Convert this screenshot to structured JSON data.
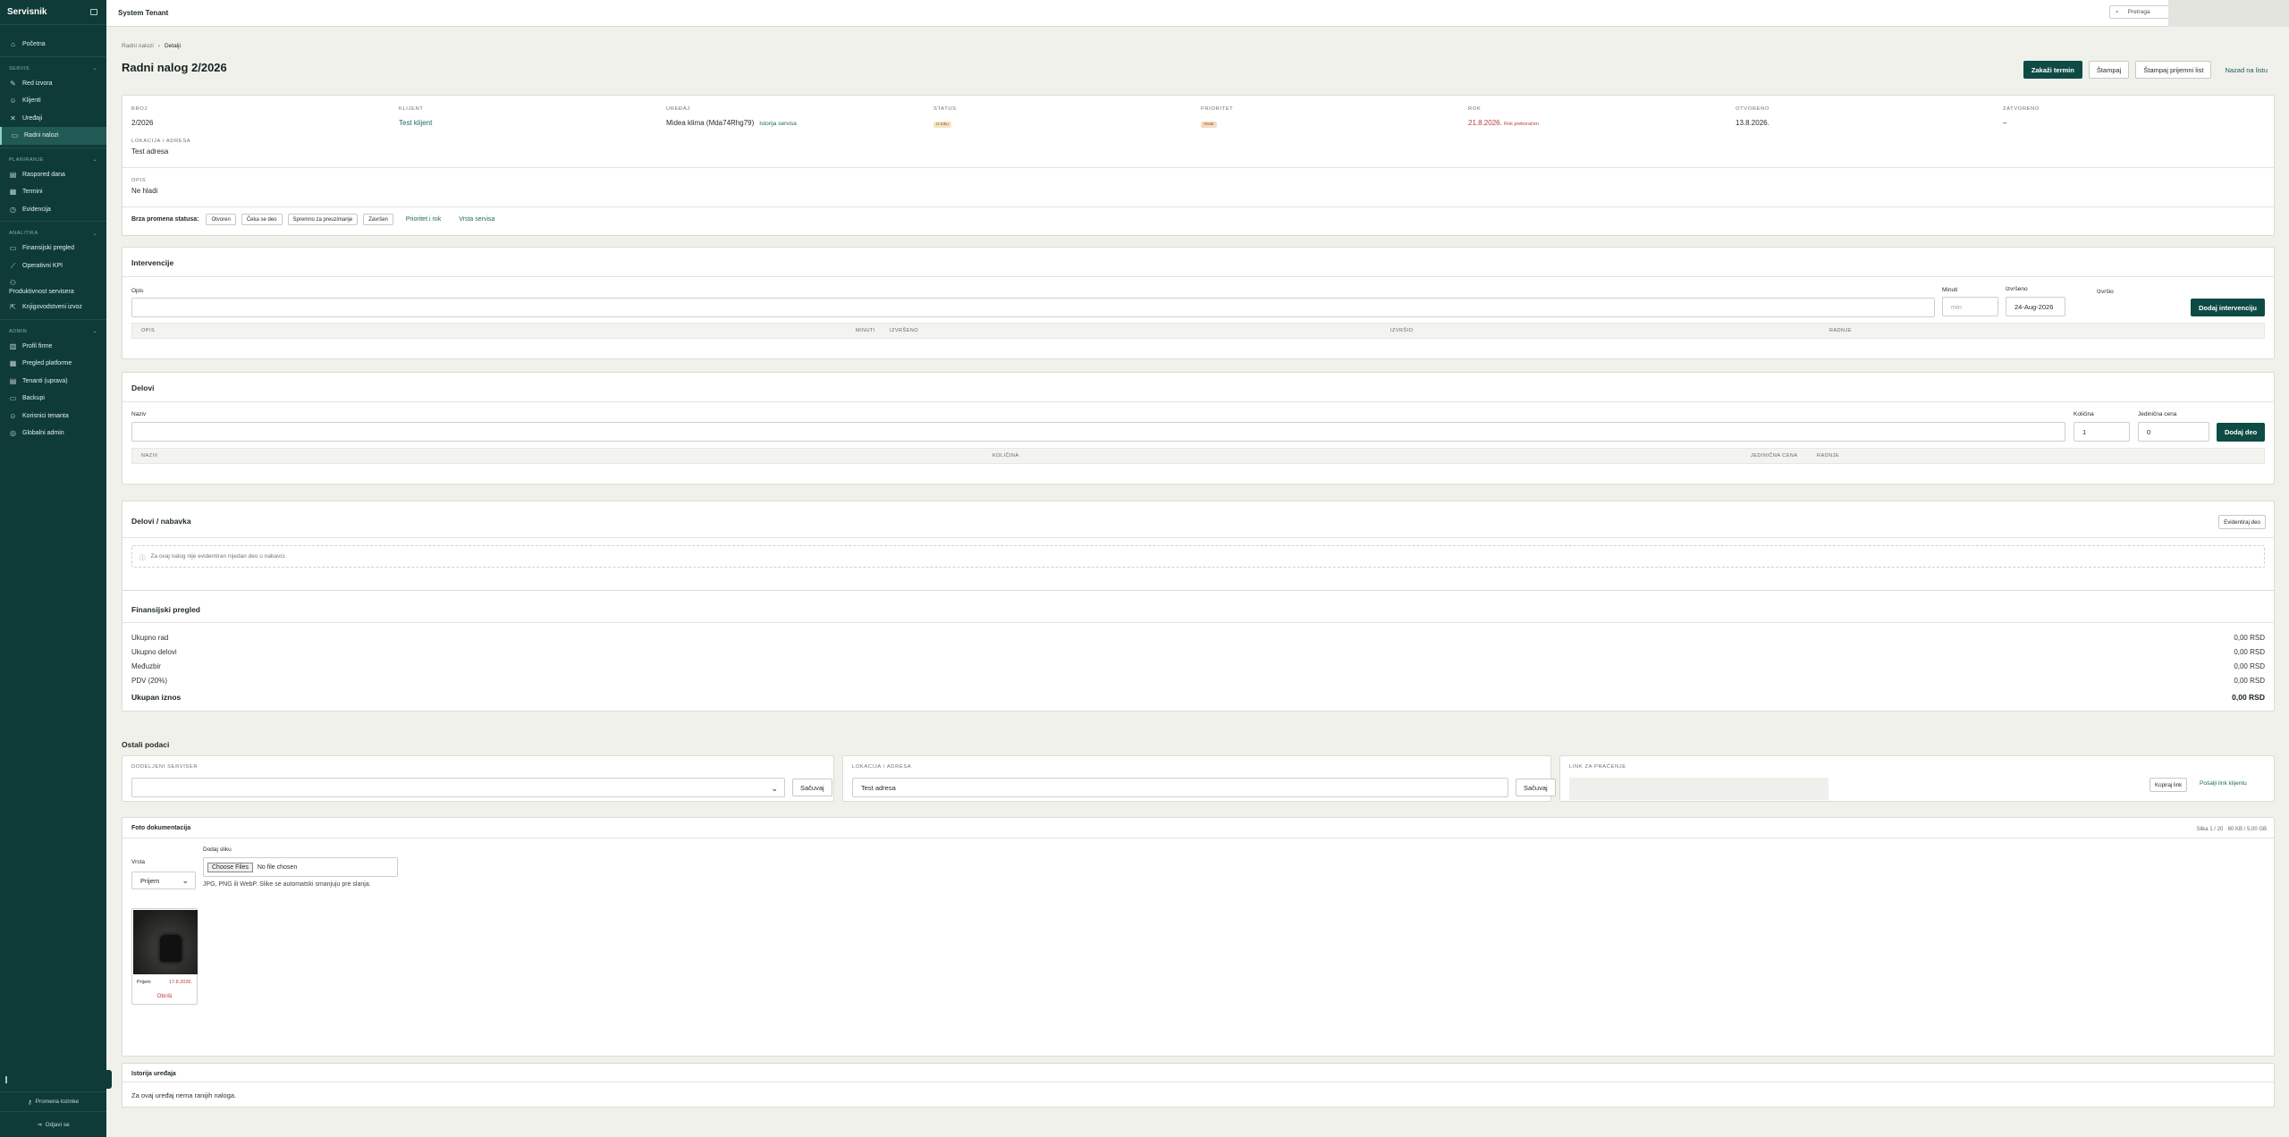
{
  "app": {
    "brand": "Servisnik",
    "tenant": "System Tenant"
  },
  "search": {
    "label": "Pretraga"
  },
  "sidebar": {
    "top_items": [
      {
        "label": "Početna",
        "icon": "home-icon"
      }
    ],
    "sections": [
      {
        "title": "SERVIS",
        "items": [
          "Red izvora",
          "Klijenti",
          "Uređaji",
          "Radni nalozi"
        ]
      },
      {
        "title": "PLANIRANJE",
        "items": [
          "Raspored dana",
          "Termini",
          "Evidencija"
        ]
      },
      {
        "title": "ANALITIKA",
        "items": [
          "Finansijski pregled",
          "Operativni KPI",
          "Produktivnost servisera",
          "Knjigovodstveni izvoz"
        ]
      },
      {
        "title": "ADMIN",
        "items": [
          "Profil firme",
          "Pregled platforme",
          "Tenanti (uprava)",
          "Backupi",
          "Korisnici tenanta",
          "Globalni admin"
        ]
      }
    ],
    "footer": {
      "promena": "Promena lozinke",
      "logout": "Odjavi se"
    }
  },
  "breadcrumb": {
    "parent": "Radni nalozi",
    "current": "Detalji"
  },
  "page": {
    "title": "Radni nalog 2/2026"
  },
  "actions": {
    "schedule": "Zakaži termin",
    "print": "Štampaj",
    "print_receipt": "Štampaj prijemni list",
    "back": "Nazad na listu"
  },
  "meta": {
    "broj": {
      "label": "BROJ",
      "value": "2/2026"
    },
    "klijent": {
      "label": "KLIJENT",
      "value": "Test klijent"
    },
    "uredjaj": {
      "label": "UREĐAJ",
      "value": "Midea klima (Mda74Rhg79)",
      "link": "Istorija servisa"
    },
    "status": {
      "label": "STATUS",
      "value": "U toku"
    },
    "prioritet": {
      "label": "PRIORITET",
      "value": "Visok"
    },
    "rok": {
      "label": "ROK",
      "value": "21.8.2026.",
      "note": "Rok prekoračen"
    },
    "otvoreno": {
      "label": "OTVORENO",
      "value": "13.8.2026."
    },
    "zatvoreno": {
      "label": "ZATVORENO",
      "value": "–"
    },
    "lokacija": {
      "label": "LOKACIJA / ADRESA",
      "value": "Test adresa"
    },
    "opis": {
      "label": "OPIS",
      "value": "Ne hladi"
    }
  },
  "quick_status": {
    "label": "Brza promena statusa:",
    "chips": [
      "Otvoren",
      "Čeka se deo",
      "Spremno za preuzimanje",
      "Završen"
    ],
    "links": [
      "Prioritet i rok",
      "Vrsta servisa"
    ]
  },
  "interventions": {
    "title": "Intervencije",
    "opis_label": "Opis",
    "minuti_label": "Minuti",
    "minuti_placeholder": "min",
    "izvrseno_label": "Izvršeno",
    "izvrseno_value": "24-Aug-2026",
    "izvrsio_label": "Izvršio",
    "add_button": "Dodaj intervenciju",
    "columns": [
      "OPIS",
      "MINUTI",
      "IZVRŠENO",
      "IZVRŠIO",
      "RADNJE"
    ]
  },
  "parts": {
    "title": "Delovi",
    "naziv_label": "Naziv",
    "kolicina_label": "Količina",
    "kolicina_value": "1",
    "cena_label": "Jedinična cena",
    "cena_value": "0",
    "add_button": "Dodaj deo",
    "columns": [
      "NAZIV",
      "KOLIČINA",
      "JEDINIČNA CENA",
      "RADNJE"
    ]
  },
  "procurement": {
    "title": "Delovi / nabavka",
    "button": "Evidentiraj deo",
    "empty": "Za ovaj nalog nije evidentiran nijedan deo u nabavci."
  },
  "finance": {
    "title": "Finansijski pregled",
    "rows": [
      {
        "label": "Ukupno rad",
        "value": "0,00 RSD"
      },
      {
        "label": "Ukupno delovi",
        "value": "0,00 RSD"
      },
      {
        "label": "Međuzbir",
        "value": "0,00 RSD"
      },
      {
        "label": "PDV (20%)",
        "value": "0,00 RSD"
      }
    ],
    "total": {
      "label": "Ukupan iznos",
      "value": "0,00 RSD"
    }
  },
  "other": {
    "title": "Ostali podaci",
    "serviser": {
      "label": "DODELJENI SERVISER",
      "button": "Sačuvaj"
    },
    "lokacija": {
      "label": "LOKACIJA / ADRESA",
      "value": "Test adresa",
      "button": "Sačuvaj"
    },
    "tracking": {
      "label": "LINK ZA PRAĆENJE",
      "copy": "Kopiraj link",
      "send": "Pošalji link klijentu"
    }
  },
  "photos": {
    "title": "Foto dokumentacija",
    "stats": "Slika 1 / 20 · 80 KB / 5,00 GB",
    "vrsta_label": "Vrsta",
    "vrsta_value": "Prijem",
    "add_label": "Dodaj sliku",
    "file_button": "Choose Files",
    "file_status": "No file chosen",
    "hint": "JPG, PNG ili WebP. Slike se automatski smanjuju pre slanja.",
    "item": {
      "type": "Prijem",
      "date": "17.8.2026.",
      "delete": "Obriši"
    }
  },
  "history": {
    "title": "Istorija uređaja",
    "empty": "Za ovaj uređaj nema ranijih naloga."
  },
  "colors": {
    "sidebar": "#0e3b37",
    "primary": "#0f4b45",
    "accent_link": "#1f6a60",
    "danger": "#b93c35",
    "status_badge": "#f6e3c3",
    "priority_badge": "#f6dcc4"
  }
}
